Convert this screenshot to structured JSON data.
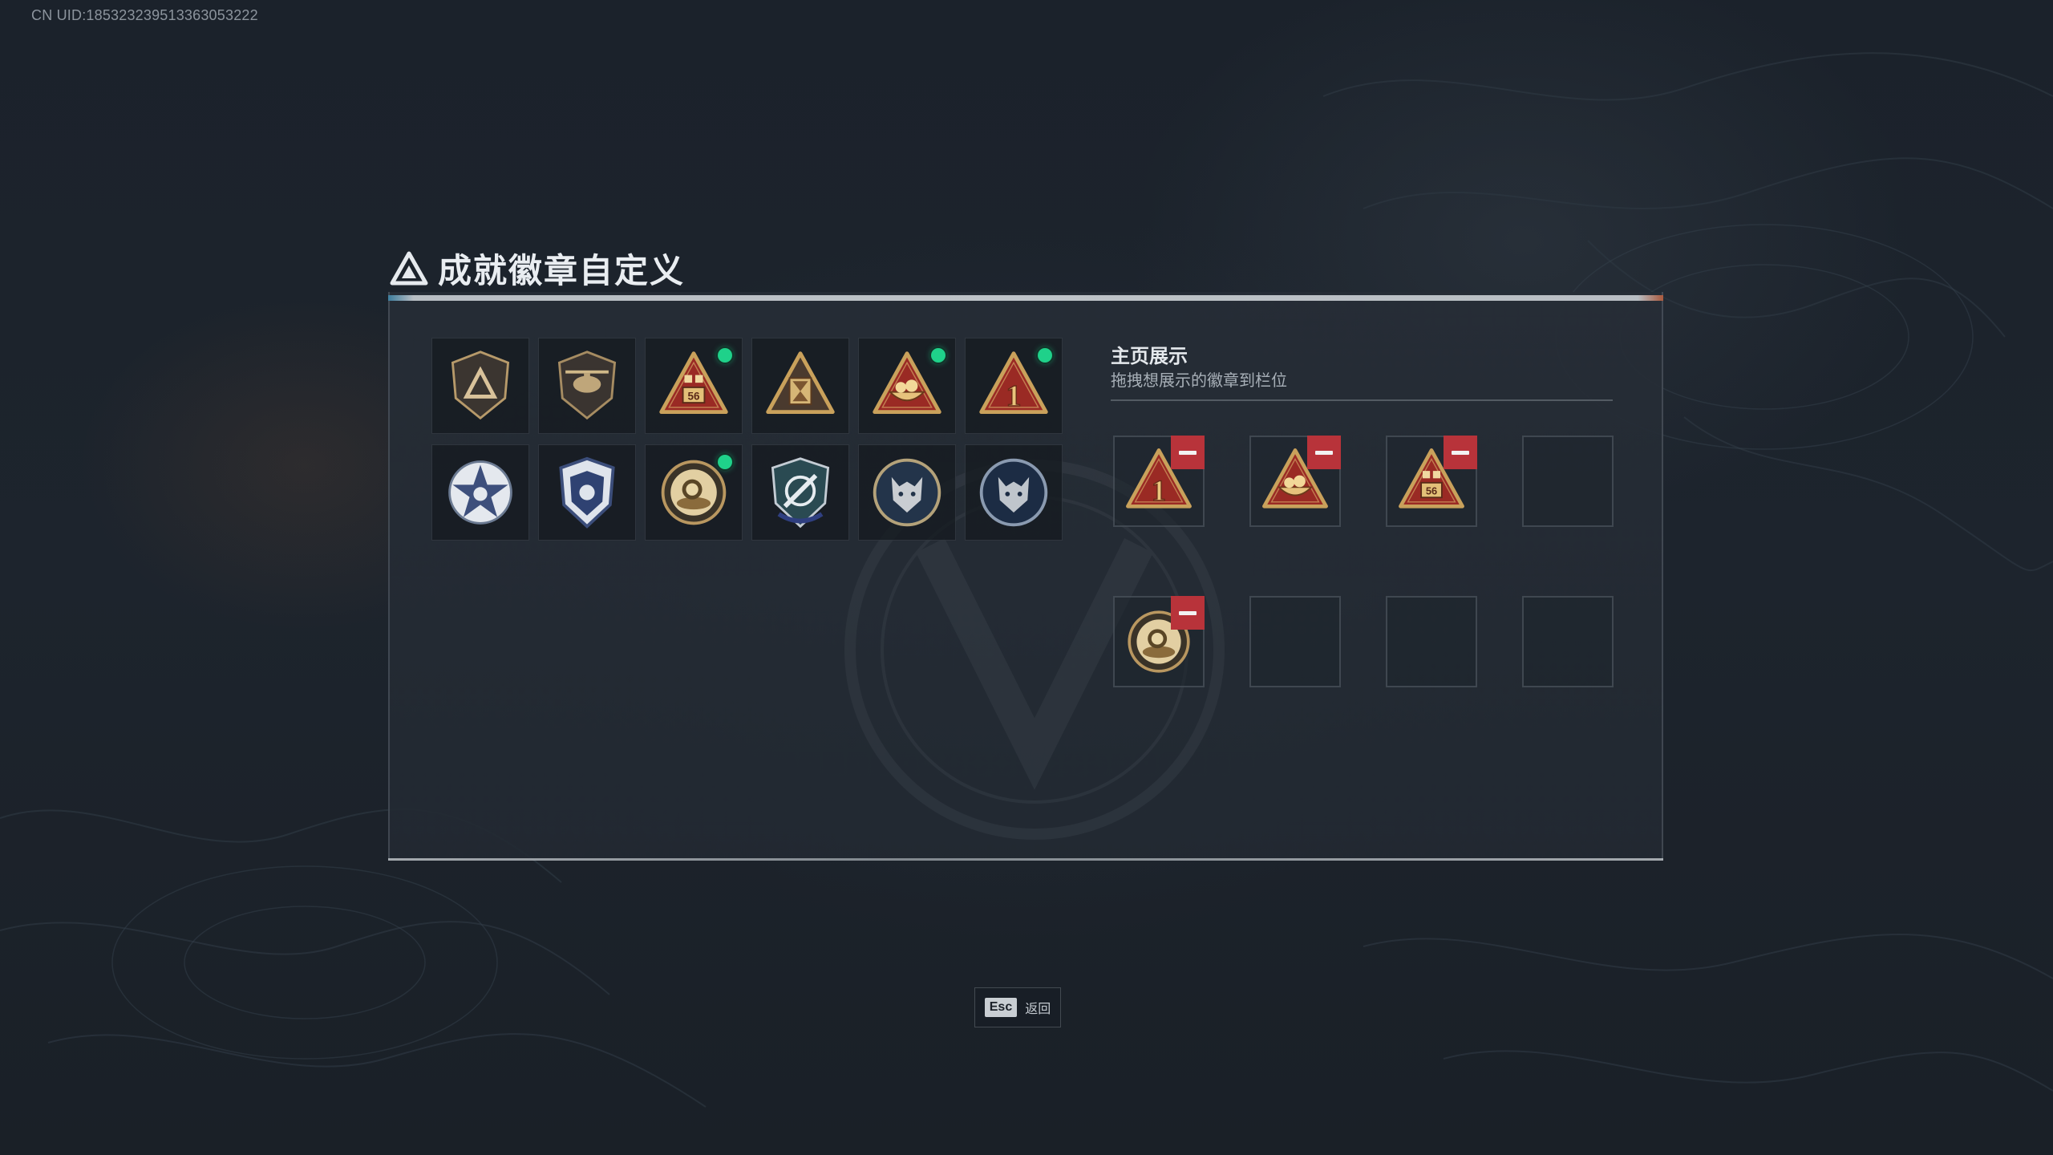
{
  "uid": "CN UID:1853232395133630532​22",
  "page": {
    "title": "成就徽章自定义"
  },
  "badges": [
    {
      "icon": "shield-triangle-badge-icon",
      "new": false
    },
    {
      "icon": "helicopter-badge-icon",
      "new": false
    },
    {
      "icon": "dice-56-triangle-badge-icon",
      "new": true
    },
    {
      "icon": "hourglass-triangle-badge-icon",
      "new": false
    },
    {
      "icon": "food-bowl-triangle-badge-icon",
      "new": true
    },
    {
      "icon": "number-one-triangle-badge-icon",
      "new": true
    },
    {
      "icon": "star-medal-badge-icon",
      "new": false
    },
    {
      "icon": "police-shield-badge-icon",
      "new": false
    },
    {
      "icon": "coin-pedestal-badge-icon",
      "new": true
    },
    {
      "icon": "crosshair-shield-badge-icon",
      "new": false
    },
    {
      "icon": "wolf-emblem-badge-icon",
      "new": false
    },
    {
      "icon": "wolf-emblem-dark-badge-icon",
      "new": false
    }
  ],
  "showcase": {
    "title": "主页展示",
    "subtitle": "拖拽想展示的徽章到栏位",
    "slots": [
      {
        "icon": "number-one-triangle-badge-icon"
      },
      {
        "icon": "food-bowl-triangle-badge-icon"
      },
      {
        "icon": "dice-56-triangle-badge-icon"
      },
      {
        "icon": null
      },
      {
        "icon": "coin-pedestal-badge-icon"
      },
      {
        "icon": null
      },
      {
        "icon": null
      },
      {
        "icon": null
      }
    ]
  },
  "footer": {
    "esc_key": "Esc",
    "esc_label": "返回"
  },
  "colors": {
    "accent_new_dot": "#1fd18a",
    "remove_button": "#b8333a",
    "badge_gold": "#c9a15b",
    "badge_red": "#9a2a24"
  }
}
